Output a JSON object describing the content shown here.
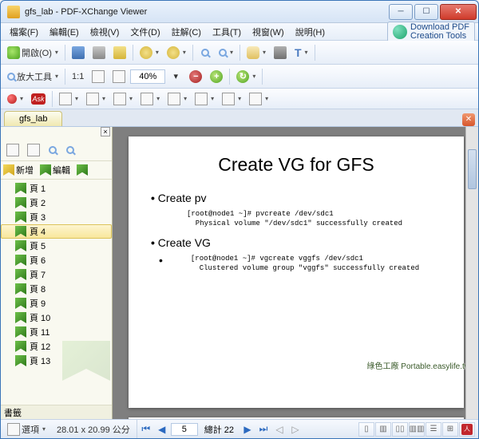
{
  "window": {
    "title": "gfs_lab - PDF-XChange Viewer"
  },
  "menu": {
    "file": "檔案(F)",
    "edit": "編輯(E)",
    "view": "檢視(V)",
    "doc": "文件(D)",
    "comment": "註解(C)",
    "tool": "工具(T)",
    "window": "視窗(W)",
    "help": "說明(H)"
  },
  "download_badge": "Download PDF\nCreation Tools",
  "toolbar": {
    "open": "開啟(O)",
    "zoom_tool": "放大工具",
    "fit_1_1": "1:1",
    "zoom_value": "40%",
    "ask": "Ask"
  },
  "tab": {
    "name": "gfs_lab"
  },
  "sidebar": {
    "add": "新增",
    "edit_label": "編輯",
    "footer": "書籤",
    "items": [
      {
        "label": "頁 1"
      },
      {
        "label": "頁 2"
      },
      {
        "label": "頁 3"
      },
      {
        "label": "頁 4"
      },
      {
        "label": "頁 5"
      },
      {
        "label": "頁 6"
      },
      {
        "label": "頁 7"
      },
      {
        "label": "頁 8"
      },
      {
        "label": "頁 9"
      },
      {
        "label": "頁 10"
      },
      {
        "label": "頁 11"
      },
      {
        "label": "頁 12"
      },
      {
        "label": "頁 13"
      }
    ],
    "active_index": 3
  },
  "page": {
    "title": "Create VG for GFS",
    "b1": "Create pv",
    "c1": "[root@node1 ~]# pvcreate /dev/sdc1\n  Physical volume \"/dev/sdc1\" successfully created",
    "b2": "Create VG",
    "c2": "[root@node1 ~]# vgcreate vggfs /dev/sdc1\n  Clustered volume group \"vggfs\" successfully created"
  },
  "watermark": "綠色工廠 Portable.easylife.tw",
  "status": {
    "options": "選項",
    "dimensions": "28.01 x 20.99 公分",
    "page_current": "5",
    "page_total": "總計 22"
  }
}
